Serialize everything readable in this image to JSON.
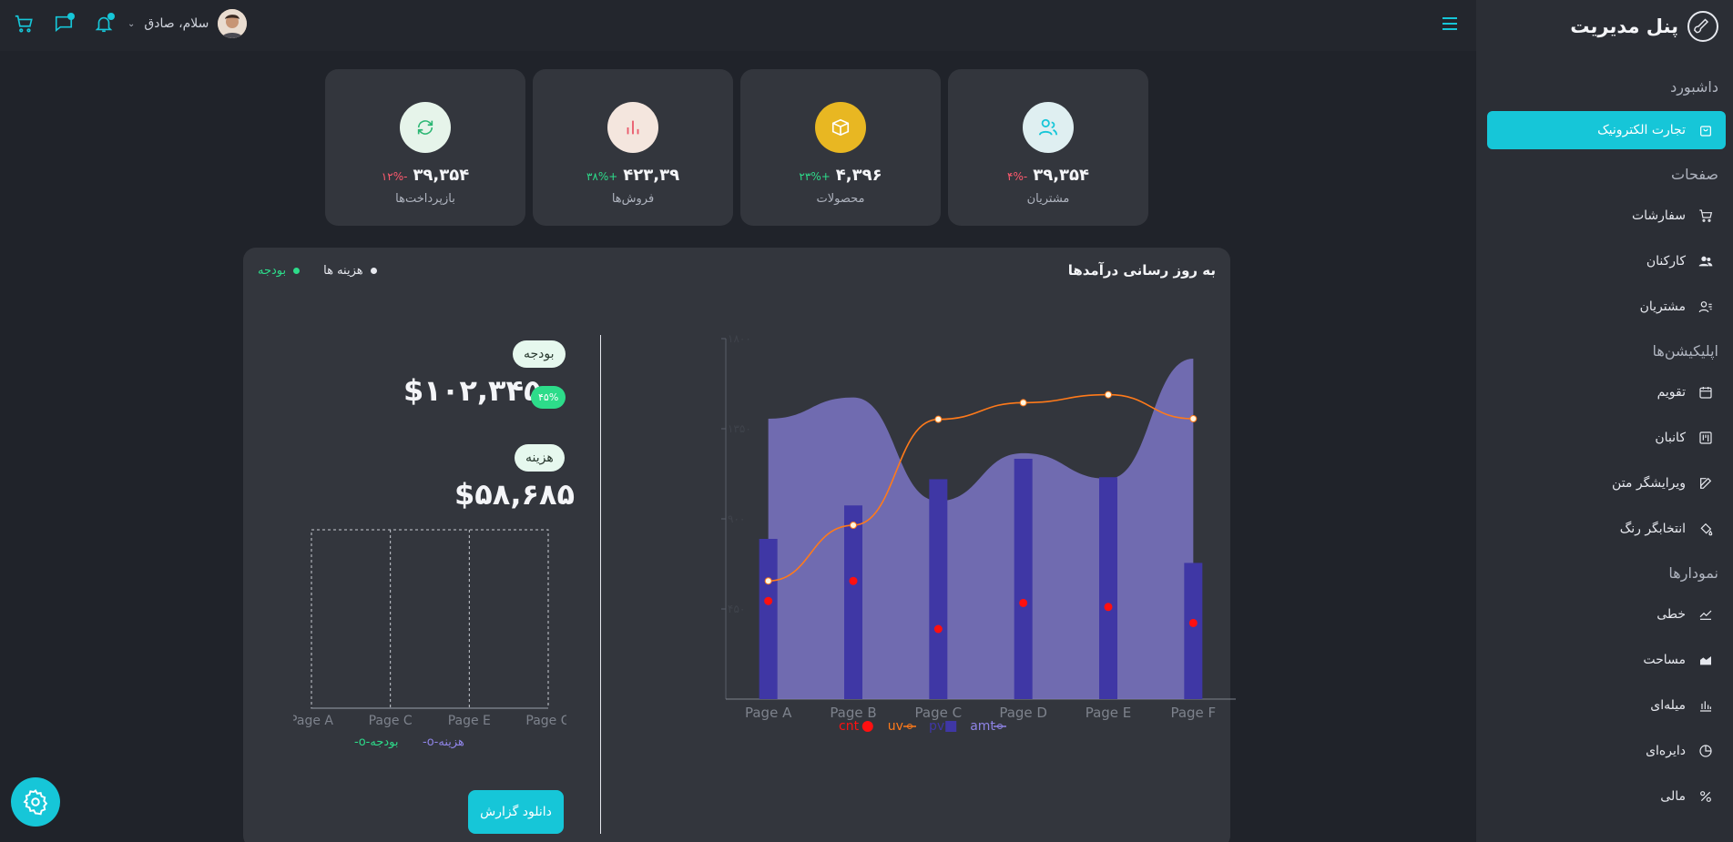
{
  "sidebar": {
    "brand": "پنل مدیریت",
    "sections": {
      "dashboard": "داشبورد",
      "pages": "صفحات",
      "apps": "اپلیکیشن‌ها",
      "charts": "نمودارها"
    },
    "items": {
      "ecommerce": "تجارت الکترونیک",
      "orders": "سفارشات",
      "employees": "کارکنان",
      "customers": "مشتریان",
      "calendar": "تقویم",
      "kanban": "کانبان",
      "editor": "ویرایشگر متن",
      "colorpicker": "انتخابگر رنگ",
      "line": "خطی",
      "area": "مساحت",
      "bar": "میله‌ای",
      "pie": "دایره‌ای",
      "financial": "مالی"
    }
  },
  "header": {
    "greeting": "سلام، صادق"
  },
  "stats": [
    {
      "label": "مشتریان",
      "value": "۳۹,۳۵۴",
      "pct": "-۴%",
      "trend": "neg",
      "icon": "users-icon",
      "circle": "#dfeff1",
      "fg": "#16c6d8"
    },
    {
      "label": "محصولات",
      "value": "۴,۳۹۶",
      "pct": "+۲۳%",
      "trend": "pos",
      "icon": "box-icon",
      "circle": "#e8b722",
      "fg": "#ffffff"
    },
    {
      "label": "فروش‌ها",
      "value": "۴۲۳,۳۹",
      "pct": "+۳۸%",
      "trend": "pos",
      "icon": "bar-chart-icon",
      "circle": "#f4e6de",
      "fg": "#ea5b6c"
    },
    {
      "label": "بازپرداخت‌ها",
      "value": "۳۹,۳۵۴",
      "pct": "-۱۲%",
      "trend": "neg",
      "icon": "refresh-icon",
      "circle": "#e6f4ea",
      "fg": "#2bb673"
    }
  ],
  "panel": {
    "title": "به روز رسانی درآمدها",
    "legend": {
      "expenses": "هزینه ها",
      "budget": "بودجه"
    },
    "budget_pill": "بودجه",
    "budget_value": "$۱۰۲,۳۴۵",
    "budget_badge": "۴۵%",
    "expense_pill": "هزینه",
    "expense_value": "$۵۸,۶۸۵",
    "mini_legend": {
      "expense": "هزینه",
      "budget": "بودجه"
    },
    "download": "دانلود گزارش"
  },
  "colors": {
    "accent": "#16c6d8",
    "positive": "#2ddc8a",
    "negative": "#ff5a6e",
    "area": "#7b74c4",
    "bar": "#3f37a5",
    "line": "#ff7a1a",
    "dot": "#ff1010"
  },
  "chart_data": [
    {
      "type": "area",
      "x": [
        "Page A",
        "Page B",
        "Page C",
        "Page D",
        "Page E",
        "Page F"
      ],
      "ylim": [
        0,
        1800
      ],
      "yticks": [
        "۴۵۰",
        "۹۰۰",
        "۱۳۵۰",
        "۱۸۰۰"
      ],
      "series": [
        {
          "name": "amt",
          "kind": "area",
          "values": [
            1400,
            1506,
            989,
            1228,
            1100,
            1700
          ]
        },
        {
          "name": "pv",
          "kind": "bar",
          "values": [
            800,
            967,
            1098,
            1200,
            1108,
            680
          ]
        },
        {
          "name": "uv",
          "kind": "line",
          "values": [
            590,
            868,
            1397,
            1480,
            1520,
            1400
          ]
        },
        {
          "name": "cnt",
          "kind": "scatter",
          "values": [
            490,
            590,
            350,
            480,
            460,
            380
          ]
        }
      ]
    },
    {
      "type": "bar",
      "x": [
        "Page A",
        "Page C",
        "Page E",
        "Page G"
      ],
      "series": [
        {
          "name": "هزینه",
          "values": []
        },
        {
          "name": "بودجه",
          "values": []
        }
      ]
    }
  ]
}
